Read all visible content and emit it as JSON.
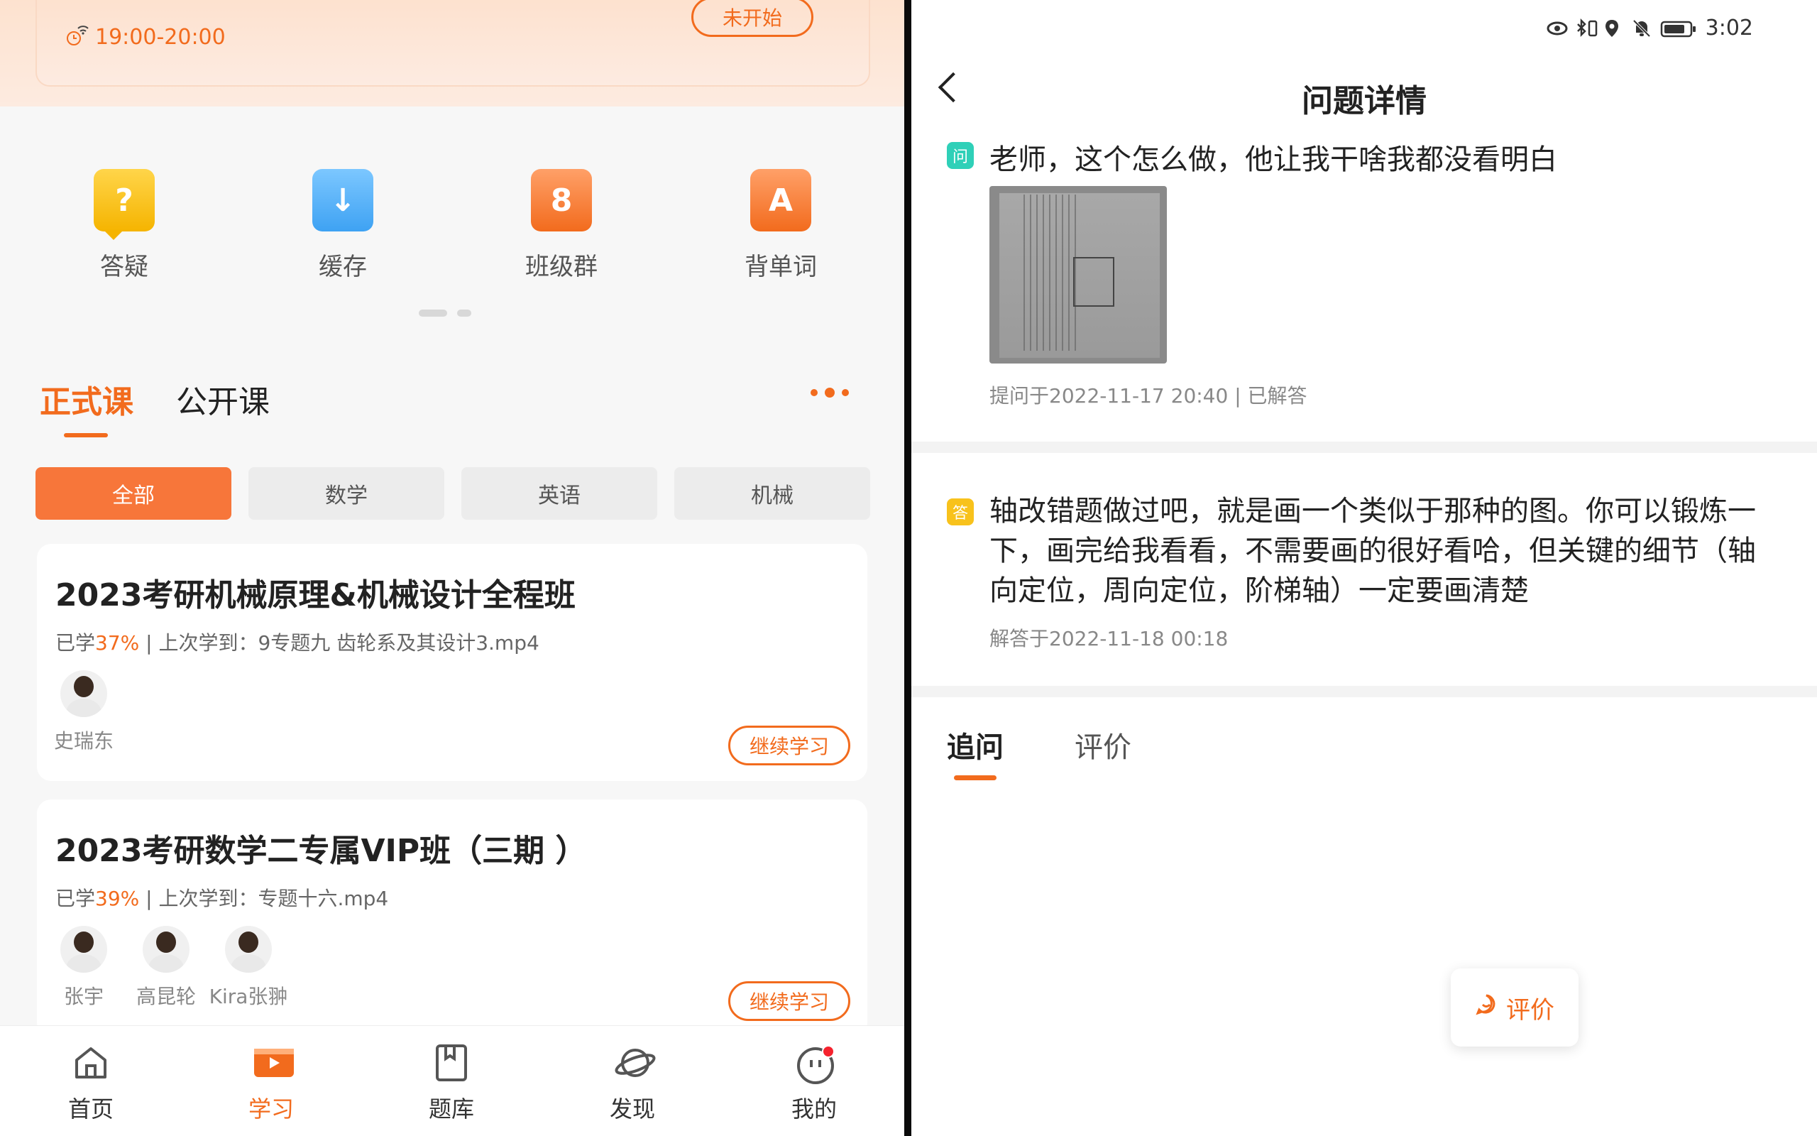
{
  "left": {
    "live": {
      "time": "19:00-20:00",
      "status": "未开始"
    },
    "quick_actions": [
      {
        "label": "答疑",
        "icon": "question-bubble-icon",
        "glyph": "?"
      },
      {
        "label": "缓存",
        "icon": "download-folder-icon",
        "glyph": "↓"
      },
      {
        "label": "班级群",
        "icon": "class-group-icon",
        "glyph": "8"
      },
      {
        "label": "背单词",
        "icon": "vocabulary-icon",
        "glyph": "A"
      }
    ],
    "tabs": {
      "active": "正式课",
      "other": "公开课"
    },
    "filters": [
      "全部",
      "数学",
      "英语",
      "机械"
    ],
    "courses": [
      {
        "title": "2023考研机械原理&机械设计全程班",
        "progress_prefix": "已学",
        "progress": "37%",
        "last": " | 上次学到：9专题九  齿轮系及其设计3.mp4",
        "teachers": [
          "史瑞东"
        ],
        "button": "继续学习"
      },
      {
        "title": "2023考研数学二专属VIP班（三期 ）",
        "progress_prefix": "已学",
        "progress": "39%",
        "last": " | 上次学到：专题十六.mp4",
        "teachers": [
          "张宇",
          "高昆轮",
          "Kira张翀"
        ],
        "button": "继续学习"
      }
    ],
    "nav": [
      {
        "label": "首页",
        "icon": "home-icon"
      },
      {
        "label": "学习",
        "icon": "play-icon"
      },
      {
        "label": "题库",
        "icon": "book-icon"
      },
      {
        "label": "发现",
        "icon": "planet-icon"
      },
      {
        "label": "我的",
        "icon": "profile-icon"
      }
    ],
    "colors": {
      "accent": "#f26b1d"
    }
  },
  "right": {
    "status_time": "3:02",
    "title": "问题详情",
    "question": {
      "badge": "问",
      "text": "老师，这个怎么做，他让我干啥我都没看明白",
      "meta": "提问于2022-11-17 20:40 | 已解答"
    },
    "answer": {
      "badge": "答",
      "text": "轴改错题做过吧，就是画一个类似于那种的图。你可以锻炼一下，画完给我看看，不需要画的很好看哈，但关键的细节（轴向定位，周向定位，阶梯轴）一定要画清楚",
      "meta": "解答于2022-11-18 00:18"
    },
    "tabs": {
      "active": "追问",
      "other": "评价"
    },
    "fab": "评价"
  }
}
